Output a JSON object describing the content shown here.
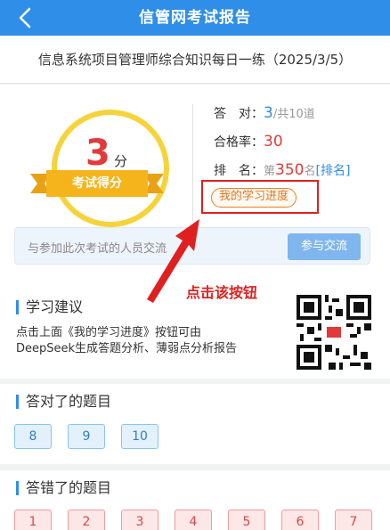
{
  "header": {
    "title": "信管网考试报告",
    "back_icon": "chevron-left-icon"
  },
  "exam": {
    "name": "信息系统项目管理师综合知识每日一练（2025/3/5）"
  },
  "score": {
    "value": "3",
    "unit": "分",
    "label": "考试得分"
  },
  "stats": {
    "correct_label": "答　对：",
    "correct_value": "3",
    "correct_total": "/共10道",
    "pass_rate_label": "合格率：",
    "pass_rate_value": "30",
    "rank_label": "排　名：",
    "rank_prefix": "第",
    "rank_value": "350",
    "rank_suffix": "名",
    "rank_link": "[排名]"
  },
  "progress_button": {
    "label": "我的学习进度"
  },
  "discussion": {
    "placeholder_text": "与参加此次考试的人员交流",
    "button_label": "参与交流"
  },
  "annotation": {
    "text": "点击该按钮"
  },
  "advice": {
    "title": "学习建议",
    "line1": "点击上面《我的学习进度》按钮可由",
    "line2": "DeepSeek生成答题分析、薄弱点分析报告",
    "qr_icon": "qr-code-icon"
  },
  "correct_section": {
    "title": "答对了的题目",
    "items": [
      "8",
      "9",
      "10"
    ]
  },
  "wrong_section": {
    "title": "答错了的题目",
    "items": [
      "1",
      "2",
      "3",
      "4",
      "5",
      "6",
      "7"
    ]
  },
  "colors": {
    "primary": "#2f8ee8",
    "accent_red": "#e23a3a",
    "ribbon": "#f5b41b",
    "highlight": "#e02020"
  }
}
